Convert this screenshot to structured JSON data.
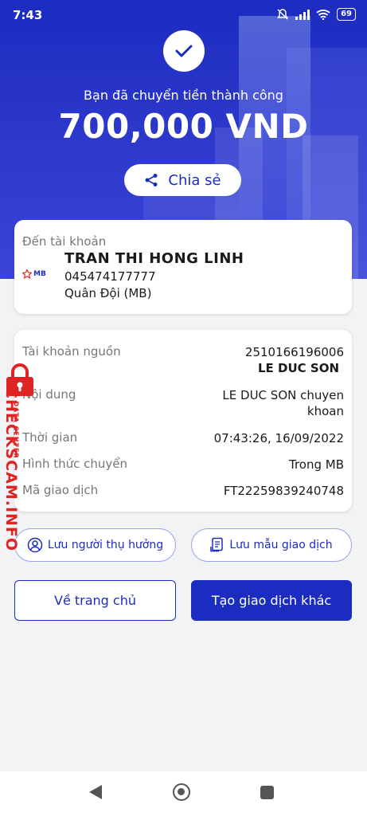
{
  "status_bar": {
    "time": "7:43",
    "battery": "69"
  },
  "hero": {
    "subtitle": "Bạn đã chuyển tiền thành công",
    "amount": "700,000 VND",
    "share_label": "Chia sẻ"
  },
  "recipient": {
    "label": "Đến tài khoản",
    "bank_logo": "MB",
    "name": "TRAN THI HONG LINH",
    "account": "045474177777",
    "bank": "Quân Đội (MB)"
  },
  "details": {
    "source_label": "Tài khoản nguồn",
    "source_account": "2510166196006",
    "source_name": "LE DUC SON",
    "content_label": "Nội dung",
    "content_line1": "LE DUC SON chuyen",
    "content_line2": "khoan",
    "time_label": "Thời gian",
    "time_value": "07:43:26, 16/09/2022",
    "method_label": "Hình thức chuyển",
    "method_value": "Trong MB",
    "txn_label": "Mã giao dịch",
    "txn_value": "FT22259839240748"
  },
  "actions": {
    "save_beneficiary": "Lưu người thụ hưởng",
    "save_template": "Lưu mẫu giao dịch",
    "home": "Về trang chủ",
    "new_transaction": "Tạo giao dịch khác"
  },
  "watermark": {
    "brand": "CHECKSCAM.INFO",
    "sub": "DATA CENTER"
  },
  "icons": [
    "check-icon",
    "share-icon",
    "user-circle-icon",
    "document-icon",
    "back-nav-icon",
    "home-nav-icon",
    "recent-nav-icon",
    "lock-icon"
  ],
  "colors": {
    "primary": "#1b2cc0",
    "watermark": "#e02424"
  }
}
